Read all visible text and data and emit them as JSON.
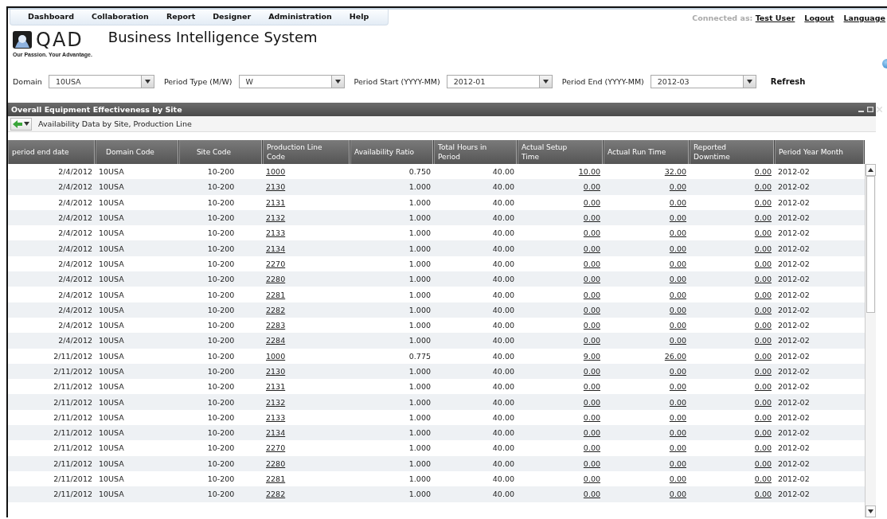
{
  "nav": {
    "menu": [
      "Dashboard",
      "Collaboration",
      "Report",
      "Designer",
      "Administration",
      "Help"
    ],
    "connected_label": "Connected as:",
    "user": "Test User",
    "links": [
      "Logout",
      "Language"
    ]
  },
  "logo": {
    "name": "QAD",
    "tagline": "Our Passion. Your Advantage."
  },
  "app_title": "Business Intelligence System",
  "filters": [
    {
      "label": "Domain",
      "value": "10USA"
    },
    {
      "label": "Period Type (M/W)",
      "value": "W"
    },
    {
      "label": "Period Start (YYYY-MM)",
      "value": "2012-01"
    },
    {
      "label": "Period End (YYYY-MM)",
      "value": "2012-03"
    }
  ],
  "refresh": "Refresh",
  "panel": {
    "title": "Overall Equipment Effectiveness by Site",
    "toolbar_label": "Availability Data by Site, Production Line",
    "table": {
      "columns": [
        {
          "label": "period end date",
          "kind": "text"
        },
        {
          "label": "Domain Code",
          "kind": "text"
        },
        {
          "label": "Site Code",
          "kind": "text"
        },
        {
          "label": "Production Line Code",
          "kind": "link"
        },
        {
          "label": "Availability Ratio",
          "kind": "text"
        },
        {
          "label": "Total Hours in Period",
          "kind": "text"
        },
        {
          "label": "Actual Setup Time",
          "kind": "link"
        },
        {
          "label": "Actual Run Time",
          "kind": "link"
        },
        {
          "label": "Reported Downtime",
          "kind": "link"
        },
        {
          "label": "Period Year Month",
          "kind": "text"
        }
      ],
      "rows": [
        [
          "2/4/2012",
          "10USA",
          "10-200",
          "1000",
          "0.750",
          "40.00",
          "10.00",
          "32.00",
          "0.00",
          "2012-02"
        ],
        [
          "2/4/2012",
          "10USA",
          "10-200",
          "2130",
          "1.000",
          "40.00",
          "0.00",
          "0.00",
          "0.00",
          "2012-02"
        ],
        [
          "2/4/2012",
          "10USA",
          "10-200",
          "2131",
          "1.000",
          "40.00",
          "0.00",
          "0.00",
          "0.00",
          "2012-02"
        ],
        [
          "2/4/2012",
          "10USA",
          "10-200",
          "2132",
          "1.000",
          "40.00",
          "0.00",
          "0.00",
          "0.00",
          "2012-02"
        ],
        [
          "2/4/2012",
          "10USA",
          "10-200",
          "2133",
          "1.000",
          "40.00",
          "0.00",
          "0.00",
          "0.00",
          "2012-02"
        ],
        [
          "2/4/2012",
          "10USA",
          "10-200",
          "2134",
          "1.000",
          "40.00",
          "0.00",
          "0.00",
          "0.00",
          "2012-02"
        ],
        [
          "2/4/2012",
          "10USA",
          "10-200",
          "2270",
          "1.000",
          "40.00",
          "0.00",
          "0.00",
          "0.00",
          "2012-02"
        ],
        [
          "2/4/2012",
          "10USA",
          "10-200",
          "2280",
          "1.000",
          "40.00",
          "0.00",
          "0.00",
          "0.00",
          "2012-02"
        ],
        [
          "2/4/2012",
          "10USA",
          "10-200",
          "2281",
          "1.000",
          "40.00",
          "0.00",
          "0.00",
          "0.00",
          "2012-02"
        ],
        [
          "2/4/2012",
          "10USA",
          "10-200",
          "2282",
          "1.000",
          "40.00",
          "0.00",
          "0.00",
          "0.00",
          "2012-02"
        ],
        [
          "2/4/2012",
          "10USA",
          "10-200",
          "2283",
          "1.000",
          "40.00",
          "0.00",
          "0.00",
          "0.00",
          "2012-02"
        ],
        [
          "2/4/2012",
          "10USA",
          "10-200",
          "2284",
          "1.000",
          "40.00",
          "0.00",
          "0.00",
          "0.00",
          "2012-02"
        ],
        [
          "2/11/2012",
          "10USA",
          "10-200",
          "1000",
          "0.775",
          "40.00",
          "9.00",
          "26.00",
          "0.00",
          "2012-02"
        ],
        [
          "2/11/2012",
          "10USA",
          "10-200",
          "2130",
          "1.000",
          "40.00",
          "0.00",
          "0.00",
          "0.00",
          "2012-02"
        ],
        [
          "2/11/2012",
          "10USA",
          "10-200",
          "2131",
          "1.000",
          "40.00",
          "0.00",
          "0.00",
          "0.00",
          "2012-02"
        ],
        [
          "2/11/2012",
          "10USA",
          "10-200",
          "2132",
          "1.000",
          "40.00",
          "0.00",
          "0.00",
          "0.00",
          "2012-02"
        ],
        [
          "2/11/2012",
          "10USA",
          "10-200",
          "2133",
          "1.000",
          "40.00",
          "0.00",
          "0.00",
          "0.00",
          "2012-02"
        ],
        [
          "2/11/2012",
          "10USA",
          "10-200",
          "2134",
          "1.000",
          "40.00",
          "0.00",
          "0.00",
          "0.00",
          "2012-02"
        ],
        [
          "2/11/2012",
          "10USA",
          "10-200",
          "2270",
          "1.000",
          "40.00",
          "0.00",
          "0.00",
          "0.00",
          "2012-02"
        ],
        [
          "2/11/2012",
          "10USA",
          "10-200",
          "2280",
          "1.000",
          "40.00",
          "0.00",
          "0.00",
          "0.00",
          "2012-02"
        ],
        [
          "2/11/2012",
          "10USA",
          "10-200",
          "2281",
          "1.000",
          "40.00",
          "0.00",
          "0.00",
          "0.00",
          "2012-02"
        ],
        [
          "2/11/2012",
          "10USA",
          "10-200",
          "2282",
          "1.000",
          "40.00",
          "0.00",
          "0.00",
          "0.00",
          "2012-02"
        ]
      ]
    }
  }
}
